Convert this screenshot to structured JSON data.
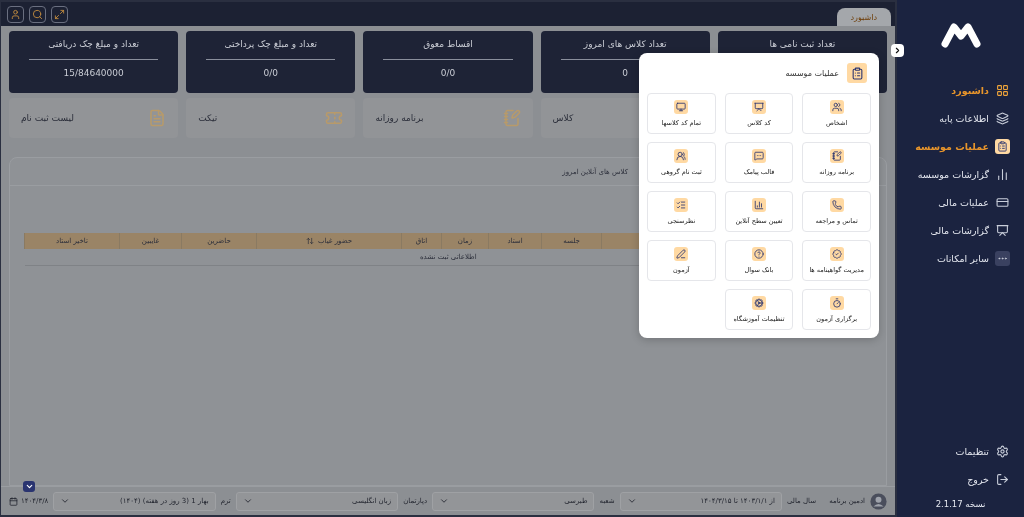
{
  "top_bar": {
    "tab": {
      "label": "داشبورد",
      "selected": true
    }
  },
  "stats": [
    {
      "title": "تعداد ثبت نامی ها"
    },
    {
      "title": "تعداد کلاس های امروز",
      "value": "0"
    },
    {
      "title": "اقساط معوق",
      "value": "0/0"
    },
    {
      "title": "تعداد و مبلغ چک پرداختی",
      "value": "0/0"
    },
    {
      "title": "تعداد و مبلغ چک دریافتی",
      "value": "15/84640000"
    }
  ],
  "shortcuts": [
    {
      "label": "کلاس"
    },
    {
      "label": "برنامه روزانه"
    },
    {
      "label": "تیکت"
    },
    {
      "label": "لیست ثبت نام"
    }
  ],
  "panel": {
    "tab": "کلاس های آنلاین امروز",
    "table": {
      "columns": [
        {
          "label": "جلسه",
          "sortable": false
        },
        {
          "label": "استاد",
          "sortable": false
        },
        {
          "label": "زمان",
          "sortable": false
        },
        {
          "label": "اتاق",
          "sortable": false
        },
        {
          "label": "حضور غیاب",
          "sortable": true
        },
        {
          "label": "حاضرین",
          "sortable": false
        },
        {
          "label": "غایبین",
          "sortable": false
        },
        {
          "label": "تاخیر استاد",
          "sortable": false
        }
      ],
      "empty_message": "اطلاعاتی ثبت نشده"
    }
  },
  "bottom_bar": {
    "user": "ادمین برنامه",
    "filters": [
      {
        "label": "سال مالی",
        "value": "از ۱۴۰۳/۱/۱ تا ۱۴۰۴/۳/۱۵"
      },
      {
        "label": "شعبه",
        "value": "طبرسی"
      },
      {
        "label": "دپارتمان",
        "value": "زبان انگلیسی"
      },
      {
        "label": "ترم",
        "value": "بهار 1 (3 روز در هفته) (۱۴۰۴)"
      }
    ],
    "date": "۱۴۰۴/۳/۸"
  },
  "sidebar": {
    "items": [
      {
        "label": "داشبورد",
        "selected": true
      },
      {
        "label": "اطلاعات پایه",
        "selected": false
      },
      {
        "label": "عملیات موسسه",
        "selected": true
      },
      {
        "label": "گزارشات موسسه",
        "selected": false
      },
      {
        "label": "عملیات مالی",
        "selected": false
      },
      {
        "label": "گزارشات مالی",
        "selected": false
      },
      {
        "label": "سایر امکانات",
        "selected": false
      }
    ],
    "footer": [
      {
        "label": "تنظیمات"
      },
      {
        "label": "خروج"
      }
    ],
    "version": "نسخه 2.1.17"
  },
  "menu": {
    "title": "عملیات موسسه",
    "items": [
      {
        "label": "اشخاص"
      },
      {
        "label": "کد کلاس"
      },
      {
        "label": "تمام کد کلاسها"
      },
      {
        "label": "برنامه روزانه"
      },
      {
        "label": "قالب پیامک"
      },
      {
        "label": "ثبت نام گروهی"
      },
      {
        "label": "تماس و مراجعه"
      },
      {
        "label": "تعیین سطح آنلاین"
      },
      {
        "label": "نظرسنجی"
      },
      {
        "label": "مدیریت گواهینامه ها"
      },
      {
        "label": "بانک سوال"
      },
      {
        "label": "آزمون"
      },
      {
        "label": "برگزاری آزمون"
      },
      {
        "label": "تنظیمات آموزشگاه"
      }
    ]
  }
}
